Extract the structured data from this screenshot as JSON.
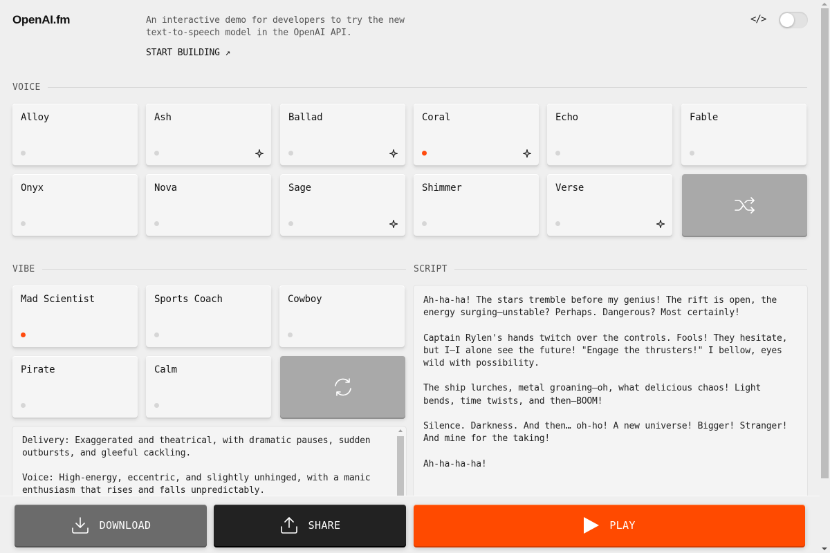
{
  "header": {
    "logo": "OpenAI.fm",
    "tagline": "An interactive demo for developers to try the new text-to-speech model in the OpenAI API.",
    "start_building": "START BUILDING ↗",
    "code_toggle_icon": "</>",
    "toggle_on": false
  },
  "voice": {
    "label": "VOICE",
    "items": [
      {
        "name": "Alloy",
        "selected": false,
        "sparkle": false
      },
      {
        "name": "Ash",
        "selected": false,
        "sparkle": true
      },
      {
        "name": "Ballad",
        "selected": false,
        "sparkle": true
      },
      {
        "name": "Coral",
        "selected": true,
        "sparkle": true
      },
      {
        "name": "Echo",
        "selected": false,
        "sparkle": false
      },
      {
        "name": "Fable",
        "selected": false,
        "sparkle": false
      },
      {
        "name": "Onyx",
        "selected": false,
        "sparkle": false
      },
      {
        "name": "Nova",
        "selected": false,
        "sparkle": false
      },
      {
        "name": "Sage",
        "selected": false,
        "sparkle": true
      },
      {
        "name": "Shimmer",
        "selected": false,
        "sparkle": false
      },
      {
        "name": "Verse",
        "selected": false,
        "sparkle": true
      }
    ],
    "shuffle_icon": "shuffle-icon"
  },
  "vibe": {
    "label": "VIBE",
    "items": [
      {
        "name": "Mad Scientist",
        "selected": true
      },
      {
        "name": "Sports Coach",
        "selected": false
      },
      {
        "name": "Cowboy",
        "selected": false
      },
      {
        "name": "Pirate",
        "selected": false
      },
      {
        "name": "Calm",
        "selected": false
      }
    ],
    "refresh_icon": "refresh-icon",
    "description": "Delivery: Exaggerated and theatrical, with dramatic pauses, sudden outbursts, and gleeful cackling.\n\nVoice: High-energy, eccentric, and slightly unhinged, with a manic enthusiasm that rises and falls unpredictably."
  },
  "script": {
    "label": "SCRIPT",
    "text": "Ah-ha-ha! The stars tremble before my genius! The rift is open, the energy surging—unstable? Perhaps. Dangerous? Most certainly!\n\nCaptain Rylen's hands twitch over the controls. Fools! They hesitate, but I—I alone see the future! \"Engage the thrusters!\" I bellow, eyes wild with possibility.\n\nThe ship lurches, metal groaning—oh, what delicious chaos! Light bends, time twists, and then—BOOM!\n\nSilence. Darkness. And then… oh-ho! A new universe! Bigger! Stranger! And mine for the taking!\n\nAh-ha-ha-ha!"
  },
  "actions": {
    "download": "DOWNLOAD",
    "share": "SHARE",
    "play": "PLAY"
  },
  "colors": {
    "accent": "#ff4a00",
    "background": "#efefef",
    "card": "#f5f5f5",
    "action_card": "#a9a9a9",
    "download_bg": "#6b6b6b",
    "share_bg": "#222222"
  }
}
